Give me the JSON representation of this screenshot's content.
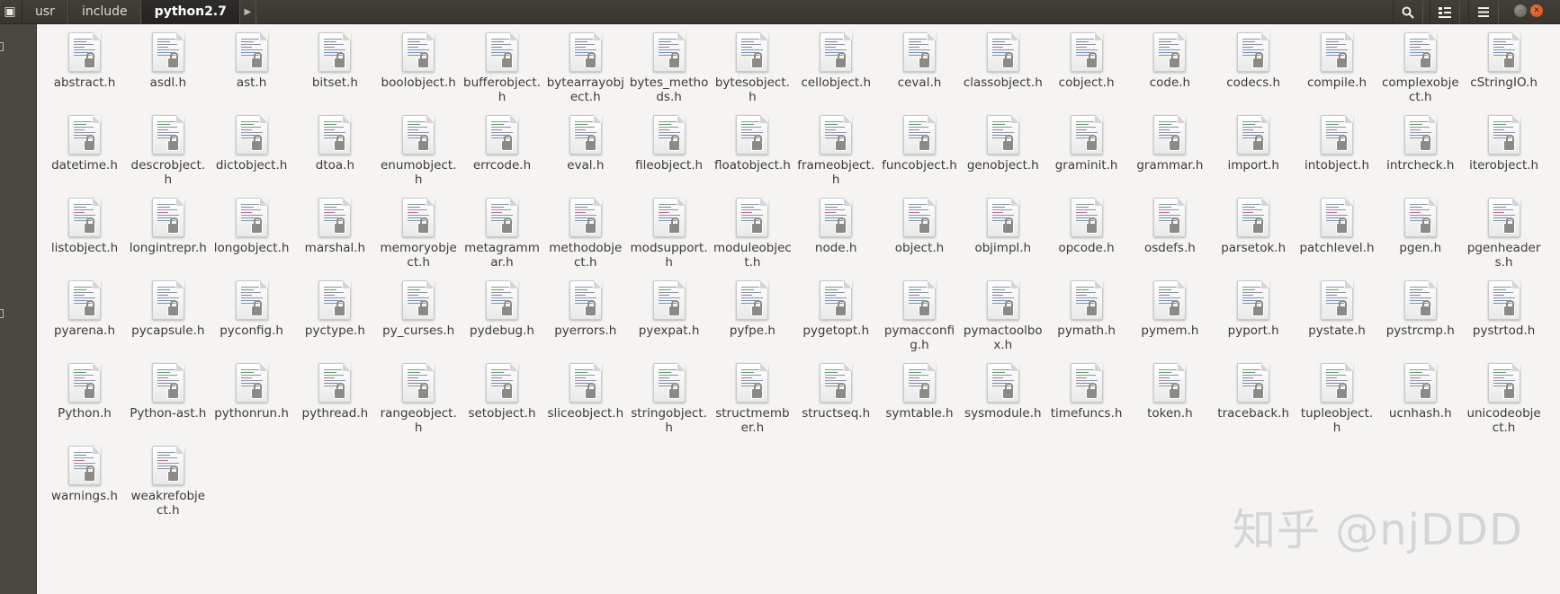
{
  "titlebar": {
    "breadcrumbs": [
      {
        "label": "usr",
        "active": false
      },
      {
        "label": "include",
        "active": false
      },
      {
        "label": "python2.7",
        "active": true
      }
    ],
    "icons": {
      "app": "file-manager-icon",
      "forward": "chevron-right-icon",
      "search": "search-icon",
      "view": "view-options-icon",
      "menu": "hamburger-menu-icon",
      "minimize": "minimize-icon",
      "close": "close-icon"
    }
  },
  "files": [
    {
      "name": "abstract.h"
    },
    {
      "name": "asdl.h"
    },
    {
      "name": "ast.h"
    },
    {
      "name": "bitset.h"
    },
    {
      "name": "boolobject.h"
    },
    {
      "name": "bufferobject.h"
    },
    {
      "name": "bytearrayobject.h"
    },
    {
      "name": "bytes_methods.h"
    },
    {
      "name": "bytesobject.h"
    },
    {
      "name": "cellobject.h"
    },
    {
      "name": "ceval.h"
    },
    {
      "name": "classobject.h"
    },
    {
      "name": "cobject.h"
    },
    {
      "name": "code.h"
    },
    {
      "name": "codecs.h"
    },
    {
      "name": "compile.h"
    },
    {
      "name": "complexobject.h"
    },
    {
      "name": "cStringIO.h"
    },
    {
      "name": "datetime.h"
    },
    {
      "name": "descrobject.h"
    },
    {
      "name": "dictobject.h"
    },
    {
      "name": "dtoa.h"
    },
    {
      "name": "enumobject.h"
    },
    {
      "name": "errcode.h"
    },
    {
      "name": "eval.h"
    },
    {
      "name": "fileobject.h"
    },
    {
      "name": "floatobject.h"
    },
    {
      "name": "frameobject.h"
    },
    {
      "name": "funcobject.h"
    },
    {
      "name": "genobject.h"
    },
    {
      "name": "graminit.h"
    },
    {
      "name": "grammar.h"
    },
    {
      "name": "import.h"
    },
    {
      "name": "intobject.h"
    },
    {
      "name": "intrcheck.h"
    },
    {
      "name": "iterobject.h"
    },
    {
      "name": "listobject.h"
    },
    {
      "name": "longintrepr.h"
    },
    {
      "name": "longobject.h"
    },
    {
      "name": "marshal.h"
    },
    {
      "name": "memoryobject.h"
    },
    {
      "name": "metagrammar.h"
    },
    {
      "name": "methodobject.h"
    },
    {
      "name": "modsupport.h"
    },
    {
      "name": "moduleobject.h"
    },
    {
      "name": "node.h"
    },
    {
      "name": "object.h"
    },
    {
      "name": "objimpl.h"
    },
    {
      "name": "opcode.h"
    },
    {
      "name": "osdefs.h"
    },
    {
      "name": "parsetok.h"
    },
    {
      "name": "patchlevel.h"
    },
    {
      "name": "pgen.h"
    },
    {
      "name": "pgenheaders.h"
    },
    {
      "name": "pyarena.h"
    },
    {
      "name": "pycapsule.h"
    },
    {
      "name": "pyconfig.h"
    },
    {
      "name": "pyctype.h"
    },
    {
      "name": "py_curses.h"
    },
    {
      "name": "pydebug.h"
    },
    {
      "name": "pyerrors.h"
    },
    {
      "name": "pyexpat.h"
    },
    {
      "name": "pyfpe.h"
    },
    {
      "name": "pygetopt.h"
    },
    {
      "name": "pymacconfig.h"
    },
    {
      "name": "pymactoolbox.h"
    },
    {
      "name": "pymath.h"
    },
    {
      "name": "pymem.h"
    },
    {
      "name": "pyport.h"
    },
    {
      "name": "pystate.h"
    },
    {
      "name": "pystrcmp.h"
    },
    {
      "name": "pystrtod.h"
    },
    {
      "name": "Python.h"
    },
    {
      "name": "Python-ast.h"
    },
    {
      "name": "pythonrun.h"
    },
    {
      "name": "pythread.h"
    },
    {
      "name": "rangeobject.h"
    },
    {
      "name": "setobject.h"
    },
    {
      "name": "sliceobject.h"
    },
    {
      "name": "stringobject.h"
    },
    {
      "name": "structmember.h"
    },
    {
      "name": "structseq.h"
    },
    {
      "name": "symtable.h"
    },
    {
      "name": "sysmodule.h"
    },
    {
      "name": "timefuncs.h"
    },
    {
      "name": "token.h"
    },
    {
      "name": "traceback.h"
    },
    {
      "name": "tupleobject.h"
    },
    {
      "name": "ucnhash.h"
    },
    {
      "name": "unicodeobject.h"
    },
    {
      "name": "warnings.h"
    },
    {
      "name": "weakrefobject.h"
    }
  ],
  "file_icon": "locked-text-file-icon",
  "watermark": "知乎 @njDDD"
}
